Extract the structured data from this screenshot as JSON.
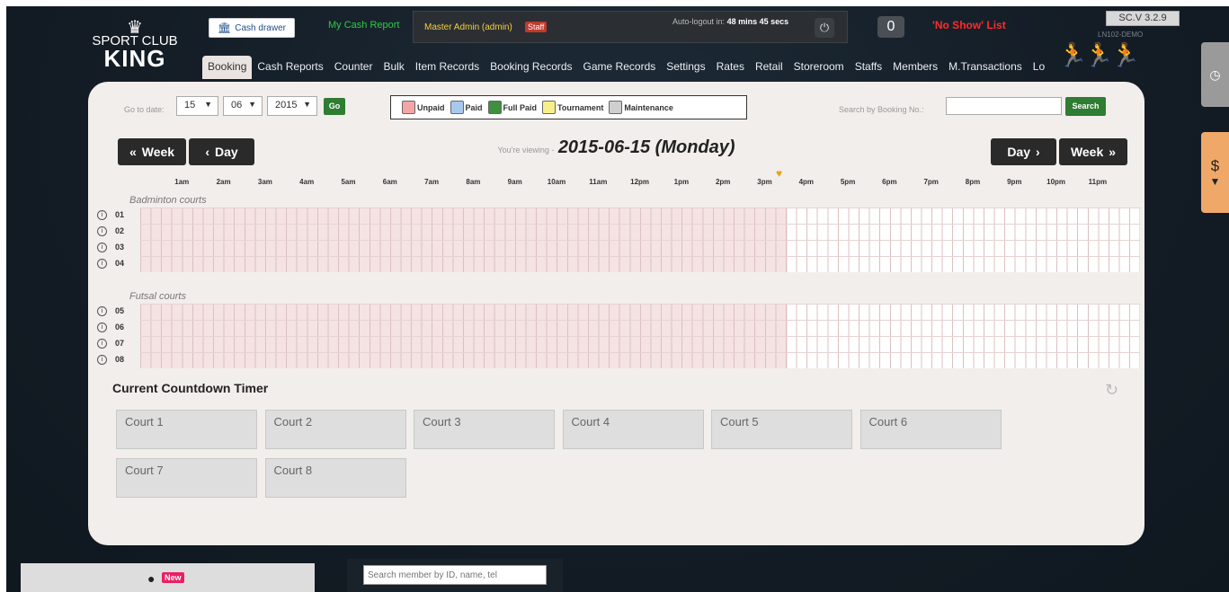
{
  "logo": {
    "line1": "SPORT CLUB",
    "line2": "KING"
  },
  "header": {
    "cash_drawer": "Cash drawer",
    "my_cash_report": "My Cash Report",
    "admin_name": "Master Admin (admin)",
    "staff_badge": "Staff",
    "autologout_label": "Auto-logout in:",
    "autologout_value": "48 mins  45 secs",
    "notification_count": "0",
    "no_show_list": "'No Show' List",
    "version": "SC.V 3.2.9",
    "environment": "LN102-DEMO"
  },
  "nav": {
    "items": [
      "Booking",
      "Cash Reports",
      "Counter",
      "Bulk",
      "Item Records",
      "Booking Records",
      "Game Records",
      "Settings",
      "Rates",
      "Retail",
      "Storeroom",
      "Staffs",
      "Members",
      "M.Transactions",
      "Lo"
    ],
    "active": "Booking"
  },
  "toolbar": {
    "goto_label": "Go to date:",
    "day": "15",
    "month": "06",
    "year": "2015",
    "go_label": "Go",
    "search_label": "Search by Booking No.:",
    "search_placeholder": "",
    "search_button": "Search"
  },
  "legend": [
    {
      "label": "Unpaid",
      "color": "#f4a6a6"
    },
    {
      "label": "Paid",
      "color": "#a9c8ee"
    },
    {
      "label": "Full Paid",
      "color": "#3f8f3f"
    },
    {
      "label": "Tournament",
      "color": "#f7ef8a"
    },
    {
      "label": "Maintenance",
      "color": "#cfcfcf"
    }
  ],
  "date_nav": {
    "prev_week": "Week",
    "prev_day": "Day",
    "next_day": "Day",
    "next_week": "Week",
    "viewing_prefix": "You're viewing -",
    "viewing_date": "2015-06-15 (Monday)"
  },
  "hours": [
    "1am",
    "2am",
    "3am",
    "4am",
    "5am",
    "6am",
    "7am",
    "8am",
    "9am",
    "10am",
    "11am",
    "12pm",
    "1pm",
    "2pm",
    "3pm",
    "4pm",
    "5pm",
    "6pm",
    "7pm",
    "8pm",
    "9pm",
    "10pm",
    "11pm"
  ],
  "sections": [
    {
      "name": "Badminton courts",
      "courts": [
        "01",
        "02",
        "03",
        "04"
      ]
    },
    {
      "name": "Futsal courts",
      "courts": [
        "05",
        "06",
        "07",
        "08"
      ]
    }
  ],
  "timer": {
    "title": "Current Countdown Timer",
    "courts": [
      "Court 1",
      "Court 2",
      "Court 3",
      "Court 4",
      "Court 5",
      "Court 6",
      "Court 7",
      "Court 8"
    ]
  },
  "bottom": {
    "new_badge": "New",
    "member_search_placeholder": "Search member by ID, name, tel"
  }
}
